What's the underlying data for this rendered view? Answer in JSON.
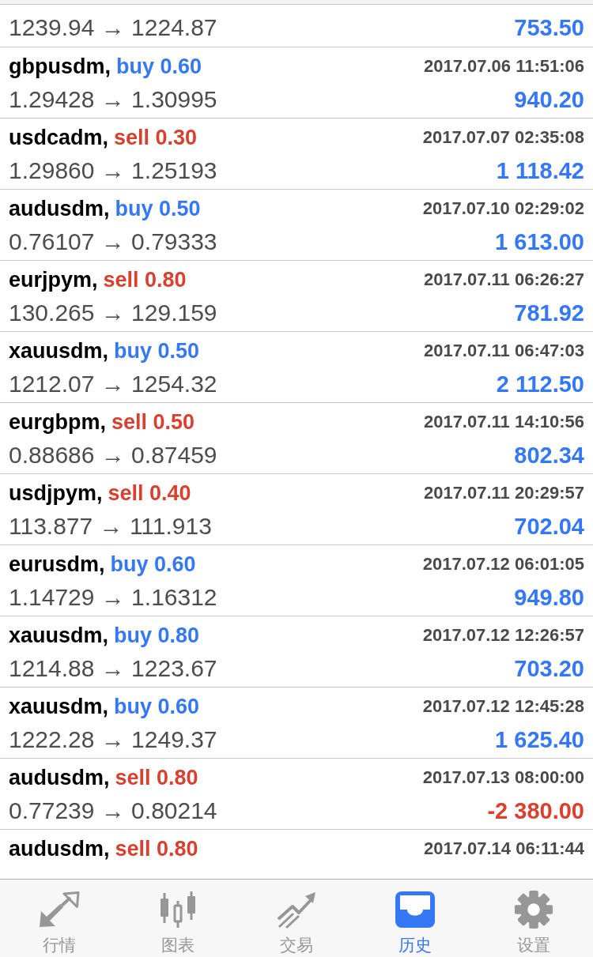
{
  "history": {
    "rows": [
      {
        "prices": "1239.94 → 1224.87",
        "profit": "753.50",
        "loss": false
      },
      {
        "symbol": "gbpusdm,",
        "order": "buy 0.60",
        "kind": "buy",
        "time": "2017.07.06 11:51:06",
        "prices": "1.29428 → 1.30995",
        "profit": "940.20",
        "loss": false
      },
      {
        "symbol": "usdcadm,",
        "order": "sell 0.30",
        "kind": "sell",
        "time": "2017.07.07 02:35:08",
        "prices": "1.29860 → 1.25193",
        "profit": "1 118.42",
        "loss": false
      },
      {
        "symbol": "audusdm,",
        "order": "buy 0.50",
        "kind": "buy",
        "time": "2017.07.10 02:29:02",
        "prices": "0.76107 → 0.79333",
        "profit": "1 613.00",
        "loss": false
      },
      {
        "symbol": "eurjpym,",
        "order": "sell 0.80",
        "kind": "sell",
        "time": "2017.07.11 06:26:27",
        "prices": "130.265 → 129.159",
        "profit": "781.92",
        "loss": false
      },
      {
        "symbol": "xauusdm,",
        "order": "buy 0.50",
        "kind": "buy",
        "time": "2017.07.11 06:47:03",
        "prices": "1212.07 → 1254.32",
        "profit": "2 112.50",
        "loss": false
      },
      {
        "symbol": "eurgbpm,",
        "order": "sell 0.50",
        "kind": "sell",
        "time": "2017.07.11 14:10:56",
        "prices": "0.88686 → 0.87459",
        "profit": "802.34",
        "loss": false
      },
      {
        "symbol": "usdjpym,",
        "order": "sell 0.40",
        "kind": "sell",
        "time": "2017.07.11 20:29:57",
        "prices": "113.877 → 111.913",
        "profit": "702.04",
        "loss": false
      },
      {
        "symbol": "eurusdm,",
        "order": "buy 0.60",
        "kind": "buy",
        "time": "2017.07.12 06:01:05",
        "prices": "1.14729 → 1.16312",
        "profit": "949.80",
        "loss": false
      },
      {
        "symbol": "xauusdm,",
        "order": "buy 0.80",
        "kind": "buy",
        "time": "2017.07.12 12:26:57",
        "prices": "1214.88 → 1223.67",
        "profit": "703.20",
        "loss": false
      },
      {
        "symbol": "xauusdm,",
        "order": "buy 0.60",
        "kind": "buy",
        "time": "2017.07.12 12:45:28",
        "prices": "1222.28 → 1249.37",
        "profit": "1 625.40",
        "loss": false
      },
      {
        "symbol": "audusdm,",
        "order": "sell 0.80",
        "kind": "sell",
        "time": "2017.07.13 08:00:00",
        "prices": "0.77239 → 0.80214",
        "profit": "-2 380.00",
        "loss": true
      },
      {
        "symbol": "audusdm,",
        "order": "sell 0.80",
        "kind": "sell",
        "time": "2017.07.14 06:11:44"
      }
    ]
  },
  "tab_bar": {
    "tabs": [
      {
        "label": "行情",
        "selected": false
      },
      {
        "label": "图表",
        "selected": false
      },
      {
        "label": "交易",
        "selected": false
      },
      {
        "label": "历史",
        "selected": true
      },
      {
        "label": "设置",
        "selected": false
      }
    ]
  }
}
